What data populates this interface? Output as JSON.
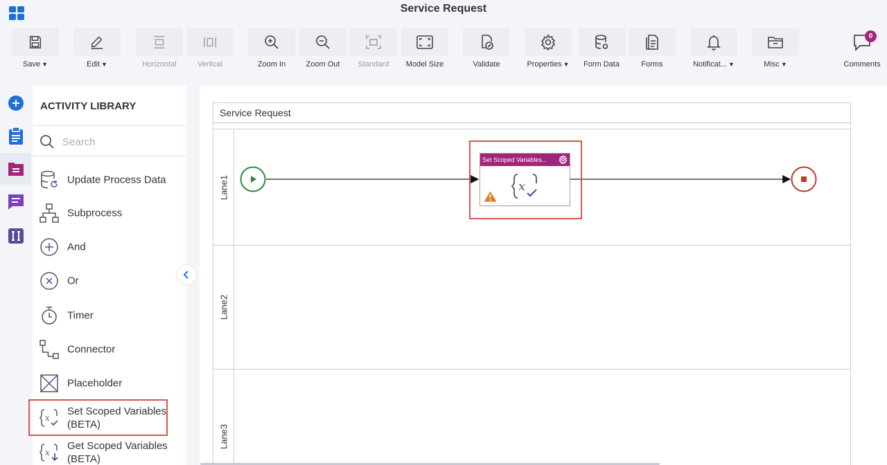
{
  "window": {
    "title": "Service Request"
  },
  "toolbar": {
    "save": "Save",
    "edit": "Edit",
    "horizontal": "Horizontal",
    "vertical": "Vertical",
    "zoom_in": "Zoom In",
    "zoom_out": "Zoom Out",
    "standard": "Standard",
    "model_size": "Model Size",
    "validate": "Validate",
    "properties": "Properties",
    "form_data": "Form Data",
    "forms": "Forms",
    "notifications": "Notificat...",
    "misc": "Misc",
    "comments": "Comments",
    "comments_count": "0"
  },
  "library": {
    "title": "ACTIVITY LIBRARY",
    "search_placeholder": "Search",
    "items": [
      {
        "label": "Update Process Data",
        "icon": "database-refresh-icon"
      },
      {
        "label": "Subprocess",
        "icon": "subprocess-icon"
      },
      {
        "label": "And",
        "icon": "plus-circle-icon"
      },
      {
        "label": "Or",
        "icon": "x-circle-icon"
      },
      {
        "label": "Timer",
        "icon": "timer-icon"
      },
      {
        "label": "Connector",
        "icon": "connector-icon"
      },
      {
        "label": "Placeholder",
        "icon": "placeholder-icon"
      },
      {
        "label": "Set Scoped Variables (BETA)",
        "icon": "set-variable-icon"
      },
      {
        "label": "Get Scoped Variables (BETA)",
        "icon": "get-variable-icon"
      }
    ]
  },
  "canvas": {
    "pool_title": "Service Request",
    "lanes": [
      "Lane1",
      "Lane2",
      "Lane3"
    ],
    "task": {
      "title": "Set Scoped Variables...",
      "icon": "set-variable-icon",
      "warning": true
    }
  },
  "colors": {
    "accent_blue": "#1f6fd8",
    "task_header": "#a3257b",
    "start_event": "#2e8b3a",
    "end_event": "#c0392b",
    "highlight": "#d9534f",
    "icon_purple": "#5b4a9b"
  }
}
